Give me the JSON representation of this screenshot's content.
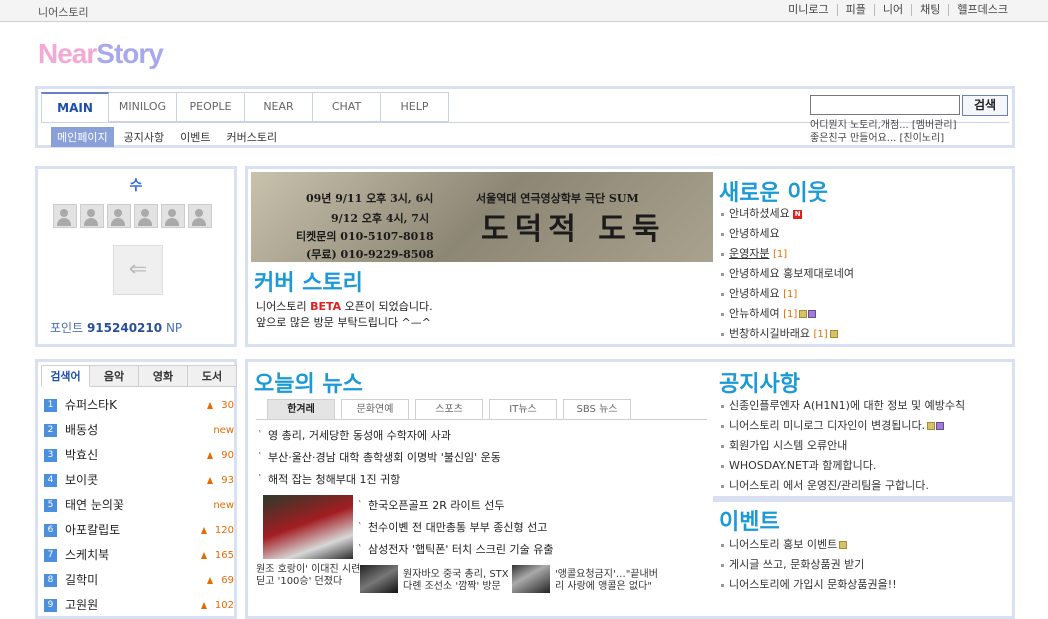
{
  "topbar": {
    "site_name": "니어스토리",
    "links": [
      "미니로그",
      "피플",
      "니어",
      "채팅",
      "헬프데스크"
    ]
  },
  "logo": {
    "near": "Near",
    "story": "Story"
  },
  "nav": {
    "tabs": [
      "MAIN",
      "MINILOG",
      "PEOPLE",
      "NEAR",
      "CHAT",
      "HELP"
    ],
    "active_tab": "MAIN",
    "subnav": [
      "메인페이지",
      "공지사항",
      "이벤트",
      "커버스토리"
    ],
    "active_subnav": "메인페이지",
    "search_button": "검색",
    "search_value": "",
    "ticker": [
      "어디뭔지 노토리,개점... [멤버관리]",
      "좋은친구 만들어요... [친이노리]"
    ]
  },
  "profile": {
    "name": "수",
    "icons": [
      "add-friend-icon",
      "favorite-friend-icon",
      "group-icon",
      "message-icon",
      "people-icon",
      "mail-icon"
    ],
    "avatar_glyph": "⇐",
    "points_label": "포인트",
    "points_value": "915240210",
    "points_unit": "NP"
  },
  "cover": {
    "banner_lines": [
      "09년 9/11 오후 3시, 6시",
      "9/12 오후 4시, 7시",
      "티켓문의 010-5107-8018",
      "(무료) 010-9229-8508"
    ],
    "banner_org": "서울역대 연극영상학부 극단 SUM",
    "banner_title": "도덕적 도둑",
    "title": "커버 스토리",
    "text_pre": "니어스토리 ",
    "text_beta": "BETA",
    "text_post": " 오픈이 되었습니다.",
    "text_line2": "앞으로 많은 방문 부탁드립니다 ^—^"
  },
  "neighbors": {
    "title": "새로운 이웃",
    "items": [
      {
        "text": "안녀하셨세요",
        "count": "",
        "badge": "N"
      },
      {
        "text": "안녕하세요",
        "count": "",
        "badge": ""
      },
      {
        "text": "운영자분",
        "count": "[1]",
        "badge": ""
      },
      {
        "text": "안녕하세요 홍보제대로네여",
        "count": "",
        "badge": ""
      },
      {
        "text": "안녕하세요",
        "count": "[1]",
        "badge": ""
      },
      {
        "text": "안뉴하세여",
        "count": "[1]",
        "badge": "img"
      },
      {
        "text": "번창하시길바래요",
        "count": "[1]",
        "badge": "img1"
      }
    ]
  },
  "ranking": {
    "tabs": [
      "검색어",
      "음악",
      "영화",
      "도서"
    ],
    "active": "검색어",
    "items": [
      {
        "rank": "1",
        "name": "슈퍼스타K",
        "change": "30"
      },
      {
        "rank": "2",
        "name": "배동성",
        "change": "new"
      },
      {
        "rank": "3",
        "name": "박효신",
        "change": "90"
      },
      {
        "rank": "4",
        "name": "보이콧",
        "change": "93"
      },
      {
        "rank": "5",
        "name": "태연 눈의꽃",
        "change": "new"
      },
      {
        "rank": "6",
        "name": "아포칼립토",
        "change": "120"
      },
      {
        "rank": "7",
        "name": "스케치북",
        "change": "165"
      },
      {
        "rank": "8",
        "name": "길학미",
        "change": "69"
      },
      {
        "rank": "9",
        "name": "고원원",
        "change": "102"
      }
    ]
  },
  "news": {
    "title": "오늘의 뉴스",
    "tabs": [
      "한겨레",
      "문화연예",
      "스포츠",
      "IT뉴스",
      "SBS 뉴스"
    ],
    "active": "한겨레",
    "top": [
      "영 총리, 거세당한 동성애 수학자에 사과",
      "부산·울산·경남 대학 총학생회 이명박 '불신임' 운동",
      "해적 잡는 청해부대 1진 귀항"
    ],
    "bottom": [
      "한국오픈골프 2R 라이트 선두",
      "천수이볜 전 대만총통 부부 종신형 선고",
      "삼성전자 '햅틱폰' 터치 스크린 기술 유출"
    ],
    "photo_caption": [
      "원조 호랑이' 이대진 시련",
      "딛고 '100승' 던졌다"
    ],
    "cap2": [
      "원자바오 중국 총리, STX",
      "다롄 조선소 '깜짝' 방문"
    ],
    "cap3": [
      "'앵콜요청금지'…\"끝내버",
      "리 사랑에 앵콜은 없다\""
    ]
  },
  "notice": {
    "title": "공지사항",
    "items": [
      {
        "text": "신종인플루엔자 A(H1N1)에 대한 정보 및 예방수칙",
        "badge": ""
      },
      {
        "text": "니어스토리 미니로그 디자인이 변경됩니다.",
        "badge": "img1"
      },
      {
        "text": "회원가입 시스템 오류안내",
        "badge": ""
      },
      {
        "text": "WHOSDAY.NET과 함께합니다.",
        "badge": ""
      },
      {
        "text": "니어스토리 에서 운영진/관리팀을 구합니다.",
        "badge": ""
      }
    ]
  },
  "event": {
    "title": "이벤트",
    "items": [
      {
        "text": "니어스토리 홍보 이벤트",
        "badge": "img"
      },
      {
        "text": "게시글 쓰고, 문화상품권 받기",
        "badge": ""
      },
      {
        "text": "니어스토리에 가입시 문화상품권을!!",
        "badge": ""
      }
    ]
  },
  "colors": {
    "accent": "#1a9ad6",
    "border": "#d9e0f2",
    "nav_active": "#1d4fa8",
    "orange": "#e56a00"
  }
}
